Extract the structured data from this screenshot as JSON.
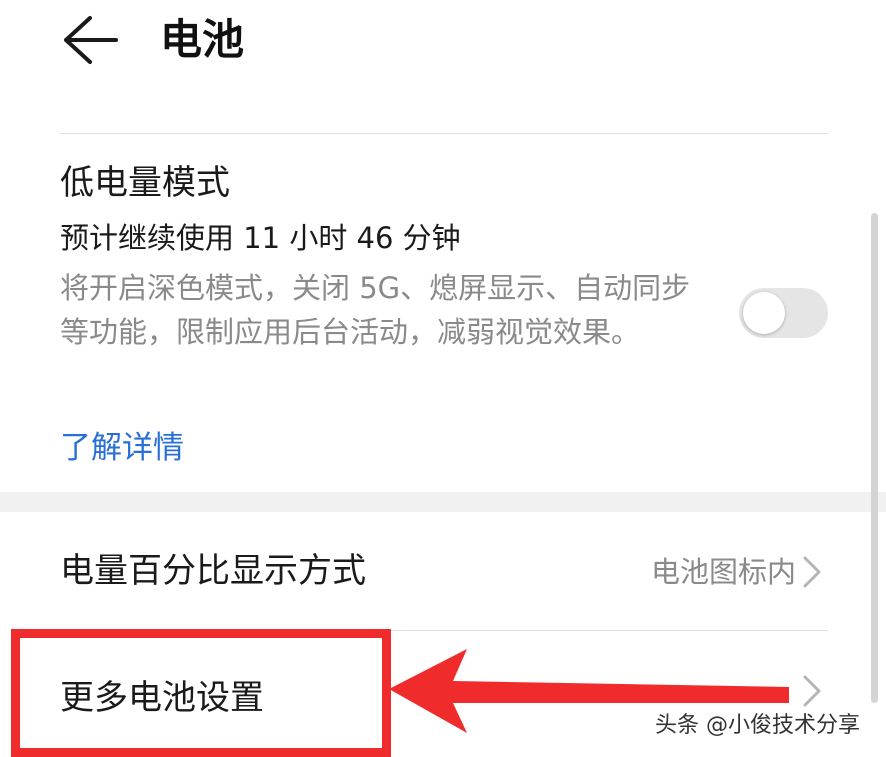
{
  "header": {
    "title": "电池",
    "back_icon": "arrow-left-icon"
  },
  "low_power": {
    "title": "低电量模式",
    "estimate": "预计继续使用 11 小时 46 分钟",
    "description": "将开启深色模式，关闭 5G、熄屏显示、自动同步等功能，限制应用后台活动，减弱视觉效果。",
    "link_label": "了解详情",
    "toggle_on": false
  },
  "settings": {
    "percent_display": {
      "label": "电量百分比显示方式",
      "value": "电池图标内"
    },
    "more_settings": {
      "label": "更多电池设置"
    }
  },
  "annotation": {
    "highlight_color": "#f02b2b",
    "arrow_color": "#f02b2b"
  },
  "watermark": "头条 @小俊技术分享",
  "colors": {
    "link": "#2a6fd6",
    "secondary_text": "#8a8a8a",
    "toggle_off": "#e5e5e5"
  }
}
